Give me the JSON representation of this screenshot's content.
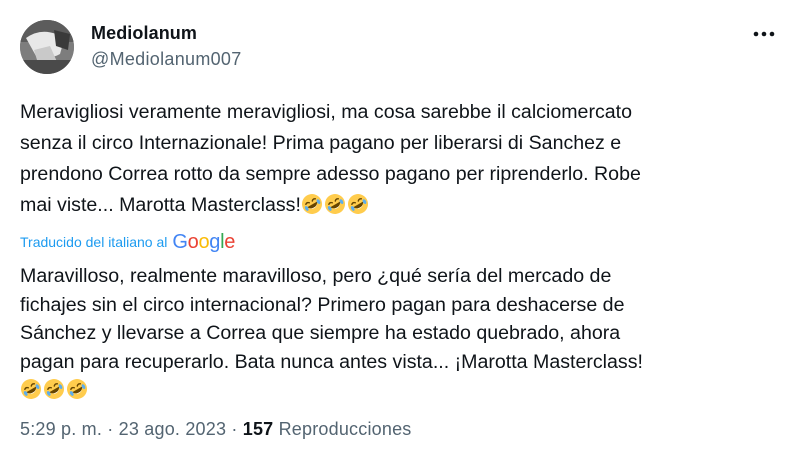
{
  "author": {
    "display_name": "Mediolanum",
    "handle": "@Mediolanum007"
  },
  "icons": {
    "more": "more-horizontal-icon",
    "emoji": "rolling-on-the-floor-laughing-emoji"
  },
  "tweet": {
    "original_text_lines": [
      "Meravigliosi veramente meravigliosi, ma cosa sarebbe il calciomercato",
      "senza il circo Internazionale! Prima pagano per liberarsi di Sanchez e",
      "prendono Correa rotto da sempre adesso pagano per riprenderlo. Robe",
      "mai viste... Marotta Masterclass!"
    ],
    "original_emoji_count": 3,
    "translation_label": "Traducido del italiano al",
    "translation_provider": "Google",
    "translated_text_lines": [
      "Maravilloso, realmente maravilloso, pero ¿qué sería del mercado de",
      "fichajes sin el circo internacional? Primero pagan para deshacerse de",
      "Sánchez y llevarse a Correa que siempre ha estado quebrado, ahora",
      "pagan para recuperarlo. Bata nunca antes vista... ¡Marotta Masterclass!"
    ],
    "translated_emoji_count": 3
  },
  "meta": {
    "time": "5:29 p. m.",
    "separator": " · ",
    "date": "23 ago. 2023",
    "views_count": "157",
    "views_label": "Reproducciones"
  },
  "colors": {
    "text": "#0f1419",
    "secondary": "#536471",
    "link": "#1d9bf0",
    "google_blue": "#4285F4",
    "google_red": "#EA4335",
    "google_yellow": "#FBBC05",
    "google_green": "#34A853"
  }
}
